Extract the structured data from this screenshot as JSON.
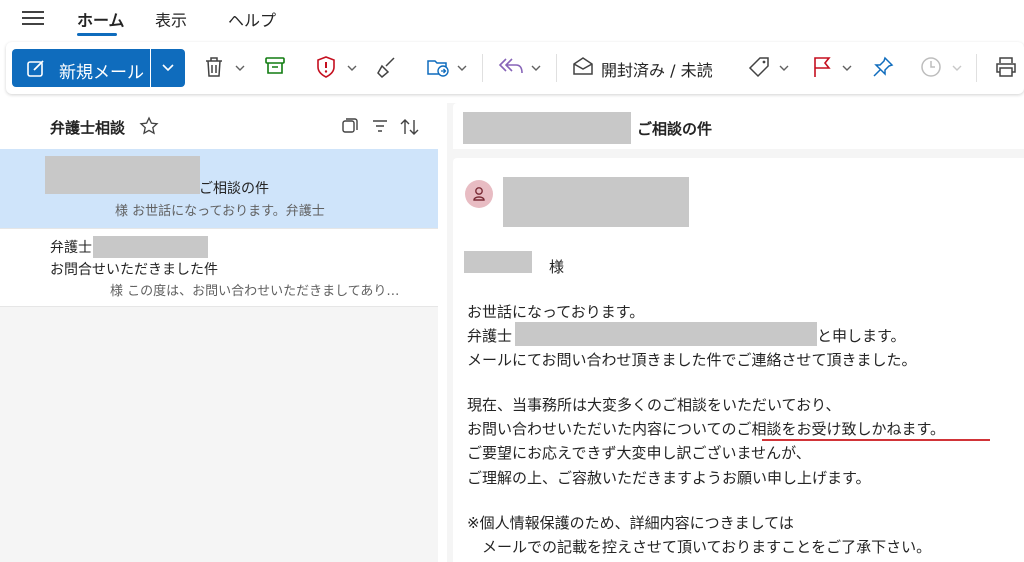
{
  "menu": {
    "tabs": [
      "ホーム",
      "表示",
      "ヘルプ"
    ],
    "active_tab": "ホーム"
  },
  "toolbar": {
    "new_mail_label": "新規メール",
    "read_unread_label": "開封済み / 未読",
    "icons": [
      "compose-icon",
      "delete-icon",
      "archive-icon",
      "report-icon",
      "sweep-icon",
      "move-icon",
      "reply-all-icon",
      "envelope-icon",
      "tag-icon",
      "flag-icon",
      "pin-icon",
      "snooze-icon",
      "print-icon"
    ],
    "colors": {
      "primary": "#0f6cbd",
      "archive": "#107c10",
      "report": "#c50f1f",
      "flag": "#c50f1f",
      "reply": "#8764b8"
    }
  },
  "list": {
    "folder_title": "弁護士相談",
    "items": [
      {
        "sender": "",
        "subject": "ご相談の件",
        "preview": "様 お世話になっております。弁護士",
        "selected": true
      },
      {
        "sender": "弁護士",
        "subject": "お問合せいただきました件",
        "preview": "様 この度は、お問い合わせいただきましてあり…",
        "selected": false
      }
    ]
  },
  "reading": {
    "subject": "ご相談の件",
    "salutation_suffix": "様",
    "body": [
      "お世話になっております。",
      "弁護士",
      "と申します。",
      "メールにてお問い合わせ頂きました件でご連絡させて頂きました。",
      "現在、当事務所は大変多くのご相談をいただいており、",
      "お問い合わせいただいた内容についてのご相談をお受け致しかねます。",
      "ご要望にお応えできず大変申し訳ございませんが、",
      "ご理解の上、ご容赦いただきますようお願い申し上げます。",
      "※個人情報保護のため、詳細内容につきましては",
      "　メールでの記載を控えさせて頂いておりますことをご了承下さい。"
    ],
    "highlight_color": "#d13438"
  }
}
